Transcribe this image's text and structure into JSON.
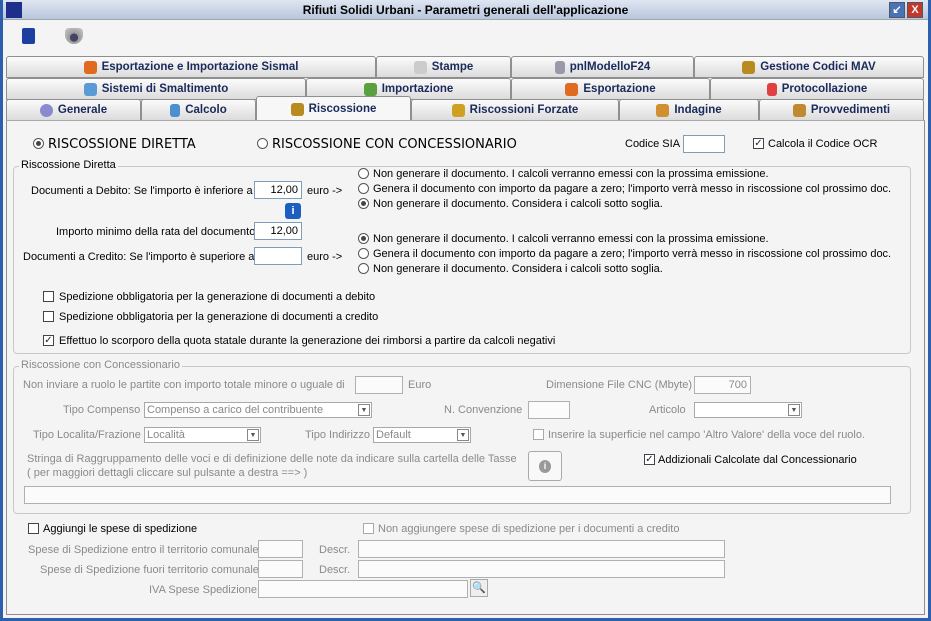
{
  "window": {
    "title": "Rifiuti Solidi Urbani - Parametri generali dell'applicazione",
    "restore": "↙",
    "close": "X"
  },
  "toolbar": {
    "save": "save-icon",
    "camera": "camera-icon"
  },
  "tabs": {
    "row1": [
      "Esportazione e Importazione Sismal",
      "Stampe",
      "pnlModelloF24",
      "Gestione Codici MAV"
    ],
    "row2": [
      "Sistemi di Smaltimento",
      "Importazione",
      "Esportazione",
      "Protocollazione"
    ],
    "row3": [
      "Generale",
      "Calcolo",
      "Riscossione",
      "Riscossioni Forzate",
      "Indagine",
      "Provvedimenti"
    ]
  },
  "mode": {
    "diretta": "RISCOSSIONE DIRETTA",
    "concessionario": "RISCOSSIONE CON CONCESSIONARIO",
    "selected": "diretta",
    "codice_sia_label": "Codice SIA",
    "codice_sia": "",
    "calcola_ocr": "Calcola il Codice OCR",
    "calcola_ocr_checked": true
  },
  "diretta": {
    "title": "Riscossione Diretta",
    "debito_label": "Documenti a Debito: Se l'importo è inferiore a",
    "debito_value": "12,00",
    "euro": "euro ->",
    "rata_label": "Importo minimo della rata del documento",
    "rata_value": "12,00",
    "credito_label": "Documenti a Credito: Se l'importo è superiore a",
    "credito_value": "",
    "debito_options": [
      "Non generare il documento. I calcoli verranno emessi con la prossima emissione.",
      "Genera il documento con importo da pagare a zero; l'importo verrà messo in riscossione col prossimo doc.",
      "Non generare il documento. Considera i calcoli sotto soglia."
    ],
    "debito_selected": 2,
    "credito_options": [
      "Non generare il documento. I calcoli verranno emessi con la prossima emissione.",
      "Genera il documento con importo da pagare a zero; l'importo verrà messo in riscossione col prossimo doc.",
      "Non generare il documento. Considera i calcoli sotto soglia."
    ],
    "credito_selected": 0,
    "checks": [
      {
        "label": "Spedizione obbligatoria per la generazione di documenti a debito",
        "checked": false
      },
      {
        "label": "Spedizione obbligatoria per la generazione di documenti a credito",
        "checked": false
      },
      {
        "label": "Effettuo lo scorporo della quota statale durante la generazione dei rimborsi a partire da calcoli negativi",
        "checked": true
      }
    ]
  },
  "concessionario": {
    "title": "Riscossione con Concessionario",
    "non_inviare_label": "Non inviare a ruolo le partite con importo totale minore o uguale di",
    "non_inviare_value": "",
    "euro": "Euro",
    "dim_file_label": "Dimensione File CNC (Mbyte)",
    "dim_file_value": "700",
    "tipo_compenso_label": "Tipo Compenso",
    "tipo_compenso_value": "Compenso a carico del contribuente",
    "n_convenzione_label": "N. Convenzione",
    "n_convenzione_value": "",
    "articolo_label": "Articolo",
    "articolo_value": "",
    "tipo_localita_label": "Tipo Localita/Frazione",
    "tipo_localita_value": "Località",
    "tipo_indirizzo_label": "Tipo Indirizzo",
    "tipo_indirizzo_value": "Default",
    "superficie_label": "Inserire la superficie nel campo 'Altro Valore' della voce del ruolo.",
    "superficie_checked": false,
    "stringa_line1": "Stringa di Raggruppamento delle voci e di definizione delle note da indicare sulla cartella delle Tasse",
    "stringa_line2": "( per maggiori dettagli cliccare sul pulsante a destra ==> )",
    "stringa_value": "",
    "addizionali_label": "Addizionali Calcolate dal Concessionario",
    "addizionali_checked": true
  },
  "spese": {
    "aggiungi_label": "Aggiungi le spese di spedizione",
    "aggiungi_checked": false,
    "non_aggiungere_label": "Non aggiungere spese di spedizione per i documenti a credito",
    "non_aggiungere_checked": false,
    "entro_label": "Spese di Spedizione entro il territorio comunale",
    "fuori_label": "Spese di Spedizione fuori territorio comunale",
    "descr_label": "Descr.",
    "iva_label": "IVA Spese Spedizione"
  }
}
